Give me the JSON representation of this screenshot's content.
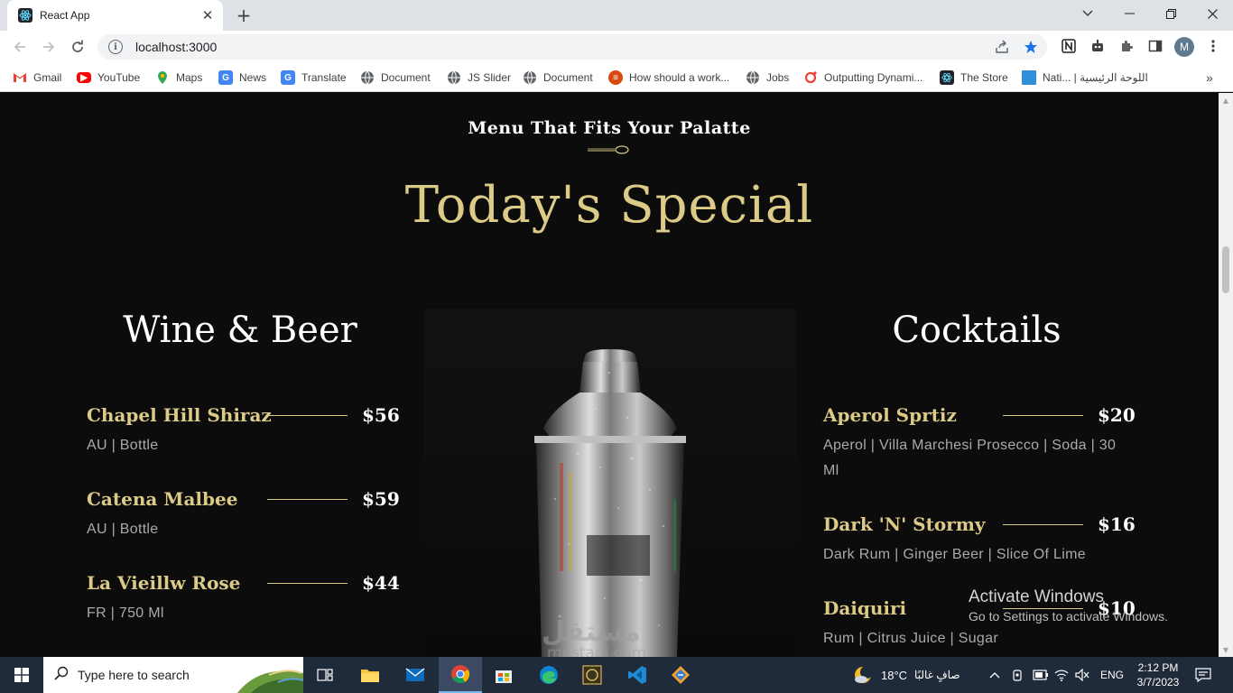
{
  "browser": {
    "tab_title": "React App",
    "url": "localhost:3000",
    "avatar_initial": "M",
    "bookmarks": [
      {
        "label": "Gmail",
        "icon": "gmail-icon",
        "color": "#ea4335"
      },
      {
        "label": "YouTube",
        "icon": "youtube-icon",
        "color": "#ff0000"
      },
      {
        "label": "Maps",
        "icon": "maps-icon",
        "color": "#34a853"
      },
      {
        "label": "News",
        "icon": "news-icon",
        "color": "#4285f4"
      },
      {
        "label": "Translate",
        "icon": "translate-icon",
        "color": "#4285f4"
      },
      {
        "label": "Document",
        "icon": "globe-icon",
        "color": "#5f6368"
      },
      {
        "label": "JS Slider",
        "icon": "globe-icon",
        "color": "#5f6368"
      },
      {
        "label": "Document",
        "icon": "globe-icon",
        "color": "#5f6368"
      },
      {
        "label": "How should a work...",
        "icon": "stack-icon",
        "color": "#d9480f"
      },
      {
        "label": "Jobs",
        "icon": "globe-icon",
        "color": "#5f6368"
      },
      {
        "label": "Outputting Dynami...",
        "icon": "codepen-icon",
        "color": "#ea4335"
      },
      {
        "label": "The Store",
        "icon": "react-icon",
        "color": "#1f2a3a"
      },
      {
        "label": "Nati... | اللوحة الرئيسية",
        "icon": "square-icon",
        "color": "#2f8fd8"
      }
    ]
  },
  "page": {
    "subtitle": "Menu That Fits Your Palatte",
    "title": "Today's Special",
    "accent_color": "#dcca87",
    "wine": {
      "title": "Wine & Beer",
      "items": [
        {
          "name": "Chapel Hill Shiraz",
          "price": "$56",
          "desc": "AU | Bottle"
        },
        {
          "name": "Catena Malbee",
          "price": "$59",
          "desc": "AU | Bottle"
        },
        {
          "name": "La Vieillw Rose",
          "price": "$44",
          "desc": "FR | 750 Ml"
        }
      ]
    },
    "cocktails": {
      "title": "Cocktails",
      "items": [
        {
          "name": "Aperol Sprtiz",
          "price": "$20",
          "desc": "Aperol | Villa Marchesi Prosecco | Soda | 30 Ml"
        },
        {
          "name": "Dark 'N' Stormy",
          "price": "$16",
          "desc": "Dark Rum | Ginger Beer | Slice Of Lime"
        },
        {
          "name": "Daiquiri",
          "price": "$10",
          "desc": "Rum | Citrus Juice | Sugar"
        }
      ]
    }
  },
  "overlay": {
    "activate_title": "Activate Windows",
    "activate_sub": "Go to Settings to activate Windows.",
    "watermark_top": "مستقل",
    "watermark_bottom": "mostaql.com"
  },
  "taskbar": {
    "search_placeholder": "Type here to search",
    "weather": "18°C",
    "weather_text": "صافٍ غالبًا",
    "language": "ENG",
    "time": "2:12 PM",
    "date": "3/7/2023"
  }
}
